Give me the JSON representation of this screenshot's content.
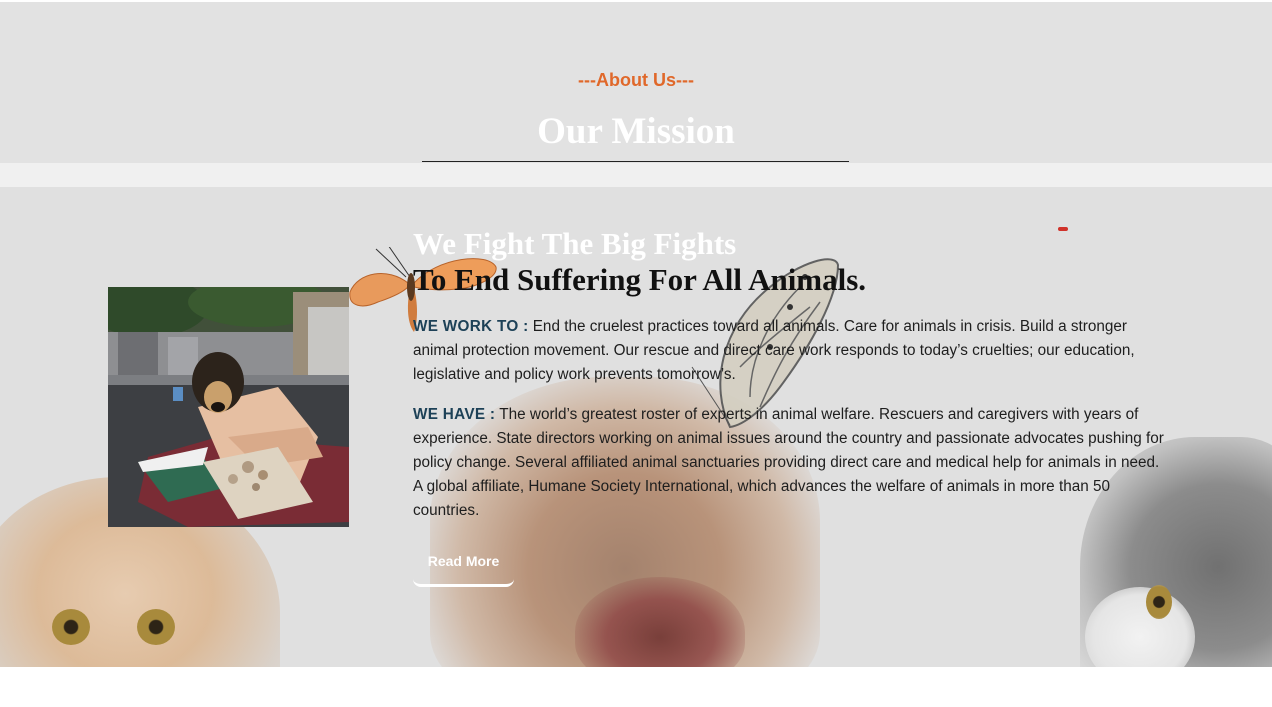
{
  "header": {
    "eyebrow": "---About Us---",
    "title": "Our Mission"
  },
  "main": {
    "headline_line1": "We Fight The Big Fights",
    "headline_line2": "To End Suffering For All Animals.",
    "paragraphs": [
      {
        "lead": "WE WORK TO :",
        "text": " End the cruelest practices toward all animals. Care for animals in crisis. Build a stronger animal protection movement. Our rescue and direct care work responds to today’s cruelties; our education, legislative and policy work prevents tomorrow’s."
      },
      {
        "lead": "WE HAVE :",
        "text": " The world’s greatest roster of experts in animal welfare. Rescuers and caregivers with years of experience. State directors working on animal issues around the country and passionate advocates pushing for policy change. Several affiliated animal sanctuaries providing direct care and medical help for animals in need. A global affiliate, Humane Society International, which advances the welfare of animals in more than 50 countries."
      }
    ],
    "read_more_label": "Read More"
  },
  "colors": {
    "eyebrow": "#e0682a",
    "lead": "#1d4157",
    "band": "#e0e0e0"
  }
}
